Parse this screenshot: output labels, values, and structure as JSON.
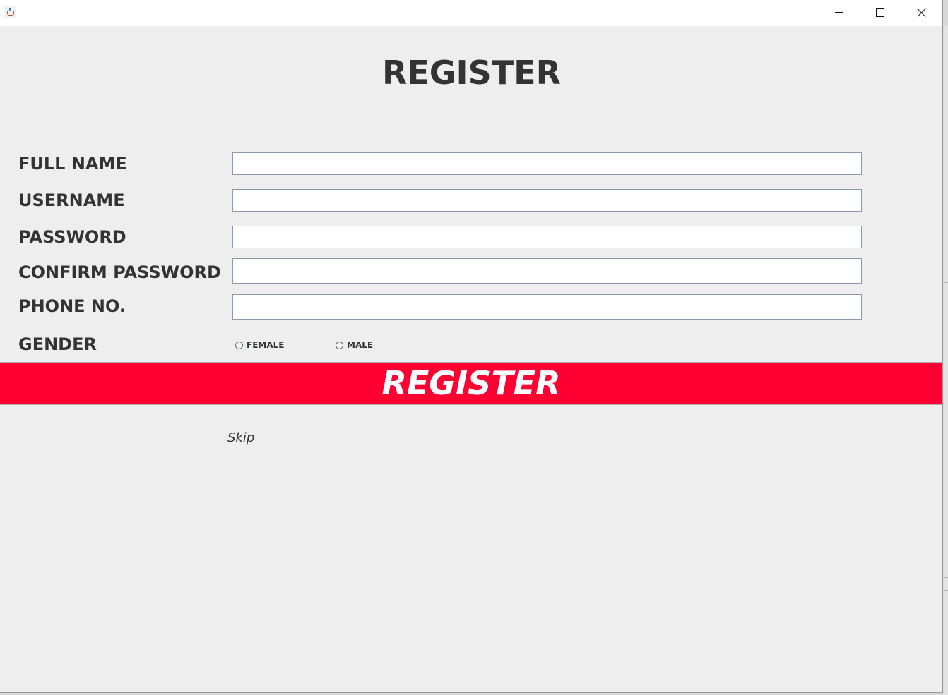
{
  "window": {
    "title": "",
    "controls": {
      "minimize_icon": "minimize-icon",
      "maximize_icon": "maximize-icon",
      "close_icon": "close-icon"
    }
  },
  "heading": "REGISTER",
  "form": {
    "full_name": {
      "label": "FULL NAME",
      "value": ""
    },
    "username": {
      "label": "USERNAME",
      "value": ""
    },
    "password": {
      "label": "PASSWORD",
      "value": ""
    },
    "confirm_password": {
      "label": "CONFIRM PASSWORD",
      "value": ""
    },
    "phone": {
      "label": "PHONE NO.",
      "value": ""
    },
    "gender": {
      "label": "GENDER",
      "options": [
        {
          "label": "FEMALE",
          "selected": false
        },
        {
          "label": "MALE",
          "selected": false
        }
      ]
    }
  },
  "register_button": "REGISTER",
  "skip_link": "Skip",
  "colors": {
    "register_button_bg": "#ff0033",
    "background": "#eeeeee",
    "text": "#333333"
  }
}
